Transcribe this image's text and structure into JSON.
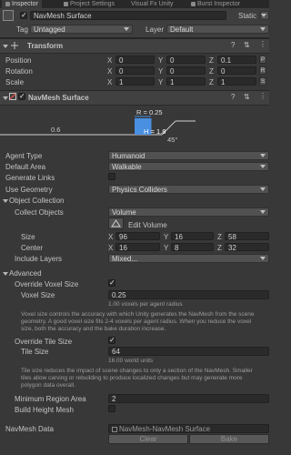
{
  "tabs": [
    "Inspector",
    "Project Settings",
    "Visual Fx Unity",
    "Burst Inspector"
  ],
  "object": {
    "name": "NavMesh Surface",
    "static_label": "Static",
    "tag_label": "Tag",
    "tag_value": "Untagged",
    "layer_label": "Layer",
    "layer_value": "Default"
  },
  "transform": {
    "title": "Transform",
    "rows": [
      {
        "label": "Position",
        "x": "0",
        "y": "0",
        "z": "0.1",
        "btn": "P"
      },
      {
        "label": "Rotation",
        "x": "0",
        "y": "0",
        "z": "0",
        "btn": "R"
      },
      {
        "label": "Scale",
        "x": "1",
        "y": "1",
        "z": "1",
        "btn": "S"
      }
    ]
  },
  "navmesh": {
    "title": "NavMesh Surface",
    "diagram": {
      "radius": "R = 0.25",
      "height": "H = 1.8",
      "step": "0.6",
      "slope": "45°"
    },
    "agent_type_label": "Agent Type",
    "agent_type": "Humanoid",
    "default_area_label": "Default Area",
    "default_area": "Walkable",
    "generate_links_label": "Generate Links",
    "use_geometry_label": "Use Geometry",
    "use_geometry": "Physics Colliders",
    "object_collection_label": "Object Collection",
    "collect_objects_label": "Collect Objects",
    "collect_objects": "Volume",
    "edit_volume_label": "Edit Volume",
    "size_label": "Size",
    "size": {
      "x": "96",
      "y": "16",
      "z": "58"
    },
    "center_label": "Center",
    "center": {
      "x": "16",
      "y": "8",
      "z": "32"
    },
    "include_layers_label": "Include Layers",
    "include_layers": "Mixed...",
    "advanced_label": "Advanced",
    "override_voxel_label": "Override Voxel Size",
    "voxel_size_label": "Voxel Size",
    "voxel_size": "0.25",
    "voxel_hint": "1.00 voxels per agent radius",
    "voxel_help": "Voxel size controls the accuracy with which Unity generates the NavMesh from the scene geometry. A good voxel size fits 2-4 voxels per agent radius. When you reduce the voxel size, both the accuracy and the bake duration increase.",
    "override_tile_label": "Override Tile Size",
    "tile_size_label": "Tile Size",
    "tile_size": "64",
    "tile_hint": "16.00 world units",
    "tile_help": "Tile size reduces the impact of scene changes to only a section of the NavMesh. Smaller tiles allow carving or rebuilding to produce localized changes but may generate more polygon data overall.",
    "min_region_label": "Minimum Region Area",
    "min_region": "2",
    "build_height_label": "Build Height Mesh",
    "navmesh_data_label": "NavMesh Data",
    "navmesh_data": "NavMesh-NavMesh Surface",
    "clear_label": "Clear",
    "bake_label": "Bake"
  },
  "colors": {
    "accent": "#4a90e2",
    "background": "#383838",
    "field": "#2a2a2a"
  }
}
